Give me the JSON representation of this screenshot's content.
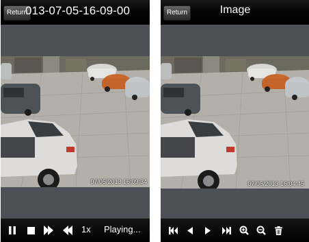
{
  "left_screen": {
    "return_label": "Return",
    "title": "013-07-05-16-09-00",
    "timestamp": "07/05/2013 16:09:34",
    "speed": "1x",
    "status": "Playing..."
  },
  "right_screen": {
    "return_label": "Return",
    "title": "Image",
    "timestamp": "07/05/2013 16:04:45"
  },
  "playback_icons": [
    "pause-icon",
    "stop-icon",
    "fast-forward-icon",
    "rewind-icon"
  ],
  "image_icons": [
    "skip-first-icon",
    "previous-icon",
    "next-icon",
    "skip-last-icon",
    "zoom-in-icon",
    "zoom-out-icon",
    "trash-icon"
  ],
  "colors": {
    "bar_background": "#000000",
    "screen_background": "#4d5057",
    "text": "#ffffff"
  }
}
